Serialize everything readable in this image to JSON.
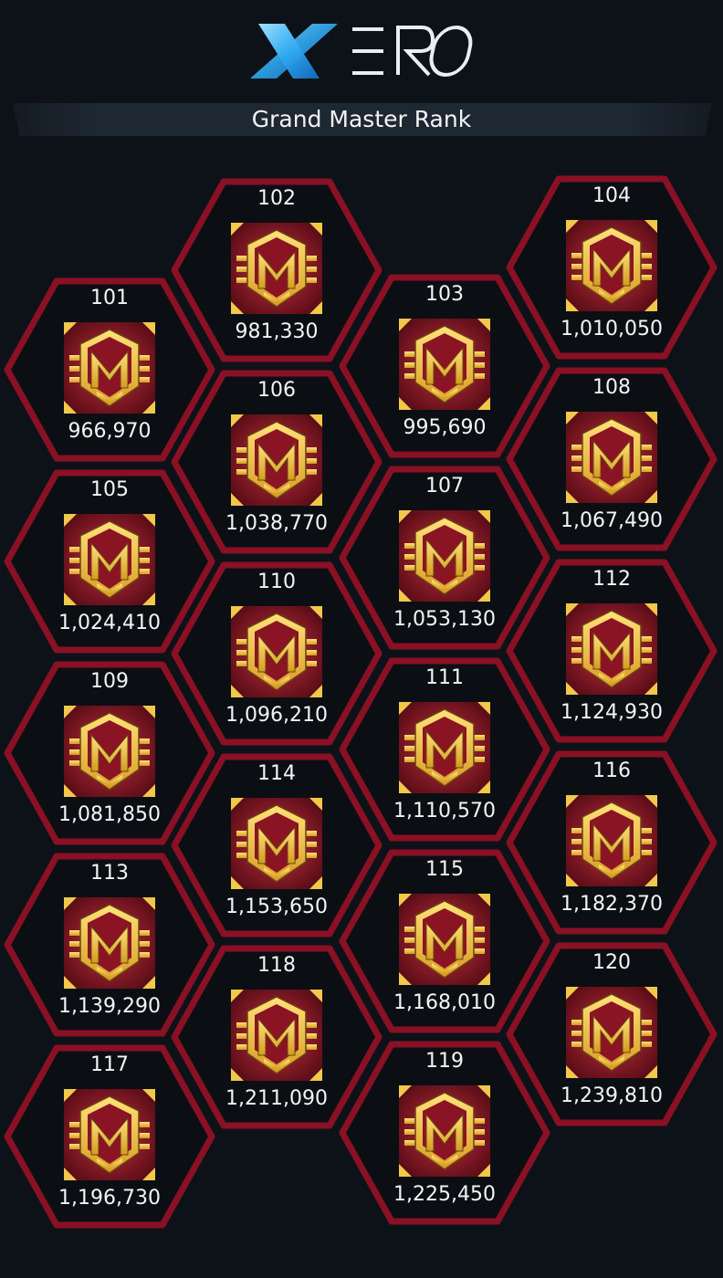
{
  "brand": {
    "logo_text": "XERO",
    "accent_color": "#2ea8f0"
  },
  "header": {
    "title": "Grand Master Rank"
  },
  "colors": {
    "hex_border": "#8a1024",
    "badge_red": "#9c1e2e",
    "badge_gold": "#f0c84a"
  },
  "badge_icon": "grand-master-emblem-icon",
  "ranks": [
    {
      "rank": "101",
      "points": "966,970"
    },
    {
      "rank": "102",
      "points": "981,330"
    },
    {
      "rank": "103",
      "points": "995,690"
    },
    {
      "rank": "104",
      "points": "1,010,050"
    },
    {
      "rank": "105",
      "points": "1,024,410"
    },
    {
      "rank": "106",
      "points": "1,038,770"
    },
    {
      "rank": "107",
      "points": "1,053,130"
    },
    {
      "rank": "108",
      "points": "1,067,490"
    },
    {
      "rank": "109",
      "points": "1,081,850"
    },
    {
      "rank": "110",
      "points": "1,096,210"
    },
    {
      "rank": "111",
      "points": "1,110,570"
    },
    {
      "rank": "112",
      "points": "1,124,930"
    },
    {
      "rank": "113",
      "points": "1,139,290"
    },
    {
      "rank": "114",
      "points": "1,153,650"
    },
    {
      "rank": "115",
      "points": "1,168,010"
    },
    {
      "rank": "116",
      "points": "1,182,370"
    },
    {
      "rank": "117",
      "points": "1,196,730"
    },
    {
      "rank": "118",
      "points": "1,211,090"
    },
    {
      "rank": "119",
      "points": "1,225,450"
    },
    {
      "rank": "120",
      "points": "1,239,810"
    }
  ]
}
